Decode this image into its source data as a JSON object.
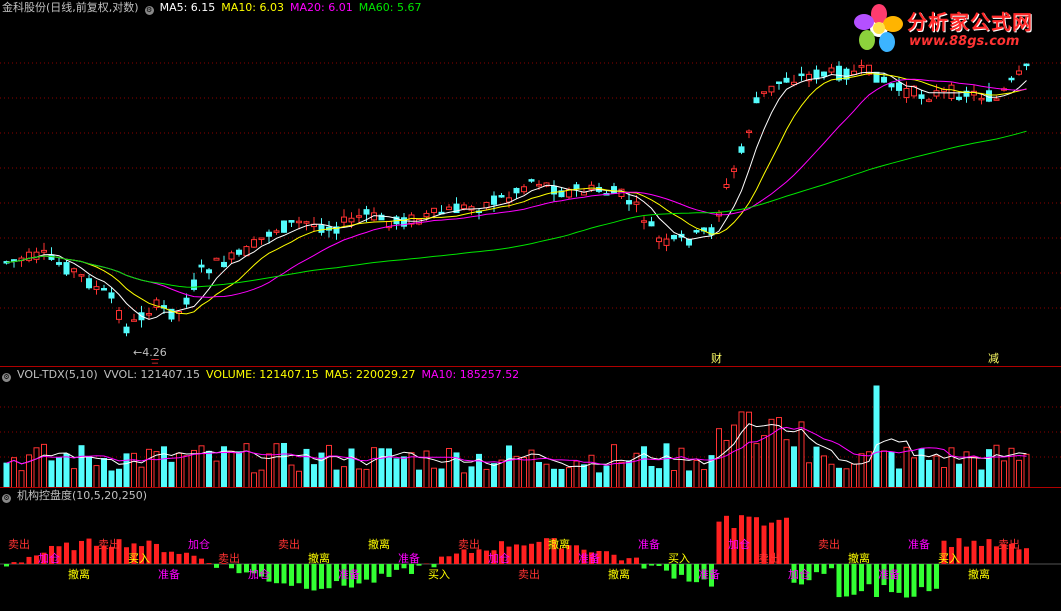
{
  "colors": {
    "up": "#ff3232",
    "down": "#54fcfc",
    "ma5": "#ffffff",
    "ma10": "#ffff00",
    "ma20": "#ff00ff",
    "ma60": "#00e600",
    "vol_ma5": "#ffffff",
    "vol_ma10": "#ff00ff",
    "grid": "#8b0000"
  },
  "logo": {
    "title": "分析家公式网",
    "url": "www.88gs.com"
  },
  "price_pane": {
    "title": "金科股份(日线,前复权,对数)",
    "ma5": "MA5: 6.15",
    "ma10": "MA10: 6.03",
    "ma20": "MA20: 6.01",
    "ma60": "MA60: 5.67",
    "low_label": "4.26",
    "low_flag": "三",
    "markers": [
      "财",
      "减"
    ]
  },
  "volume_pane": {
    "title": "VOL-TDX(5,10)",
    "vvol": "VVOL: 121407.15",
    "volume": "VOLUME: 121407.15",
    "ma5": "MA5: 220029.27",
    "ma10": "MA10: 185257.52"
  },
  "indicator_pane": {
    "title": "机构控盘度(10,5,20,250)",
    "signals": [
      {
        "t": "卖出",
        "c": "#ff3232"
      },
      {
        "t": "加仓",
        "c": "#ff00ff"
      },
      {
        "t": "撤离",
        "c": "#ffff00"
      },
      {
        "t": "卖出",
        "c": "#ff3232"
      },
      {
        "t": "买入",
        "c": "#ffff00"
      },
      {
        "t": "准备",
        "c": "#ff00ff"
      },
      {
        "t": "加仓",
        "c": "#ff00ff"
      },
      {
        "t": "卖出",
        "c": "#ff3232"
      },
      {
        "t": "加仓",
        "c": "#ff00ff"
      },
      {
        "t": "卖出",
        "c": "#ff3232"
      },
      {
        "t": "撤离",
        "c": "#ffff00"
      },
      {
        "t": "准备",
        "c": "#ff00ff"
      },
      {
        "t": "撤离",
        "c": "#ffff00"
      },
      {
        "t": "准备",
        "c": "#ff00ff"
      },
      {
        "t": "买入",
        "c": "#ffff00"
      },
      {
        "t": "卖出",
        "c": "#ff3232"
      },
      {
        "t": "加仓",
        "c": "#ff00ff"
      },
      {
        "t": "卖出",
        "c": "#ff3232"
      },
      {
        "t": "撤离",
        "c": "#ffff00"
      },
      {
        "t": "准备",
        "c": "#ff00ff"
      },
      {
        "t": "撤离",
        "c": "#ffff00"
      },
      {
        "t": "准备",
        "c": "#ff00ff"
      },
      {
        "t": "买入",
        "c": "#ffff00"
      },
      {
        "t": "准备",
        "c": "#ff00ff"
      },
      {
        "t": "加仓",
        "c": "#ff00ff"
      },
      {
        "t": "卖出",
        "c": "#ff3232"
      },
      {
        "t": "加仓",
        "c": "#ff00ff"
      },
      {
        "t": "卖出",
        "c": "#ff3232"
      },
      {
        "t": "撤离",
        "c": "#ffff00"
      },
      {
        "t": "准备",
        "c": "#ff00ff"
      },
      {
        "t": "准备",
        "c": "#ff00ff"
      },
      {
        "t": "买入",
        "c": "#ffff00"
      },
      {
        "t": "撤离",
        "c": "#ffff00"
      },
      {
        "t": "卖出",
        "c": "#ff3232"
      }
    ]
  }
}
